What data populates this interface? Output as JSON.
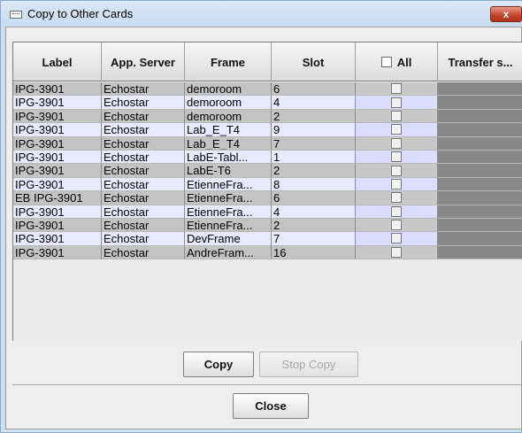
{
  "window": {
    "title": "Copy to Other Cards",
    "close_label": "x"
  },
  "table": {
    "columns": [
      "Label",
      "App. Server",
      "Frame",
      "Slot",
      "All",
      "Transfer s..."
    ],
    "rows": [
      {
        "label": "IPG-3901",
        "server": "Echostar",
        "frame": "demoroom",
        "slot": "6"
      },
      {
        "label": "IPG-3901",
        "server": "Echostar",
        "frame": "demoroom",
        "slot": "4"
      },
      {
        "label": "IPG-3901",
        "server": "Echostar",
        "frame": "demoroom",
        "slot": "2"
      },
      {
        "label": "IPG-3901",
        "server": "Echostar",
        "frame": "Lab_E_T4",
        "slot": "9"
      },
      {
        "label": "IPG-3901",
        "server": "Echostar",
        "frame": "Lab_E_T4",
        "slot": "7"
      },
      {
        "label": "IPG-3901",
        "server": "Echostar",
        "frame": "LabE-Tabl...",
        "slot": "1"
      },
      {
        "label": "IPG-3901",
        "server": "Echostar",
        "frame": "LabE-T6",
        "slot": "2"
      },
      {
        "label": "IPG-3901",
        "server": "Echostar",
        "frame": "EtienneFra...",
        "slot": "8"
      },
      {
        "label": "EB IPG-3901",
        "server": "Echostar",
        "frame": "EtienneFra...",
        "slot": "6"
      },
      {
        "label": "IPG-3901",
        "server": "Echostar",
        "frame": "EtienneFra...",
        "slot": "4"
      },
      {
        "label": "IPG-3901",
        "server": "Echostar",
        "frame": "EtienneFra...",
        "slot": "2"
      },
      {
        "label": "IPG-3901",
        "server": "Echostar",
        "frame": "DevFrame",
        "slot": "7"
      },
      {
        "label": "IPG-3901",
        "server": "Echostar",
        "frame": "AndreFram...",
        "slot": "16"
      }
    ]
  },
  "buttons": {
    "copy": "Copy",
    "stop_copy": "Stop Copy",
    "close": "Close"
  }
}
